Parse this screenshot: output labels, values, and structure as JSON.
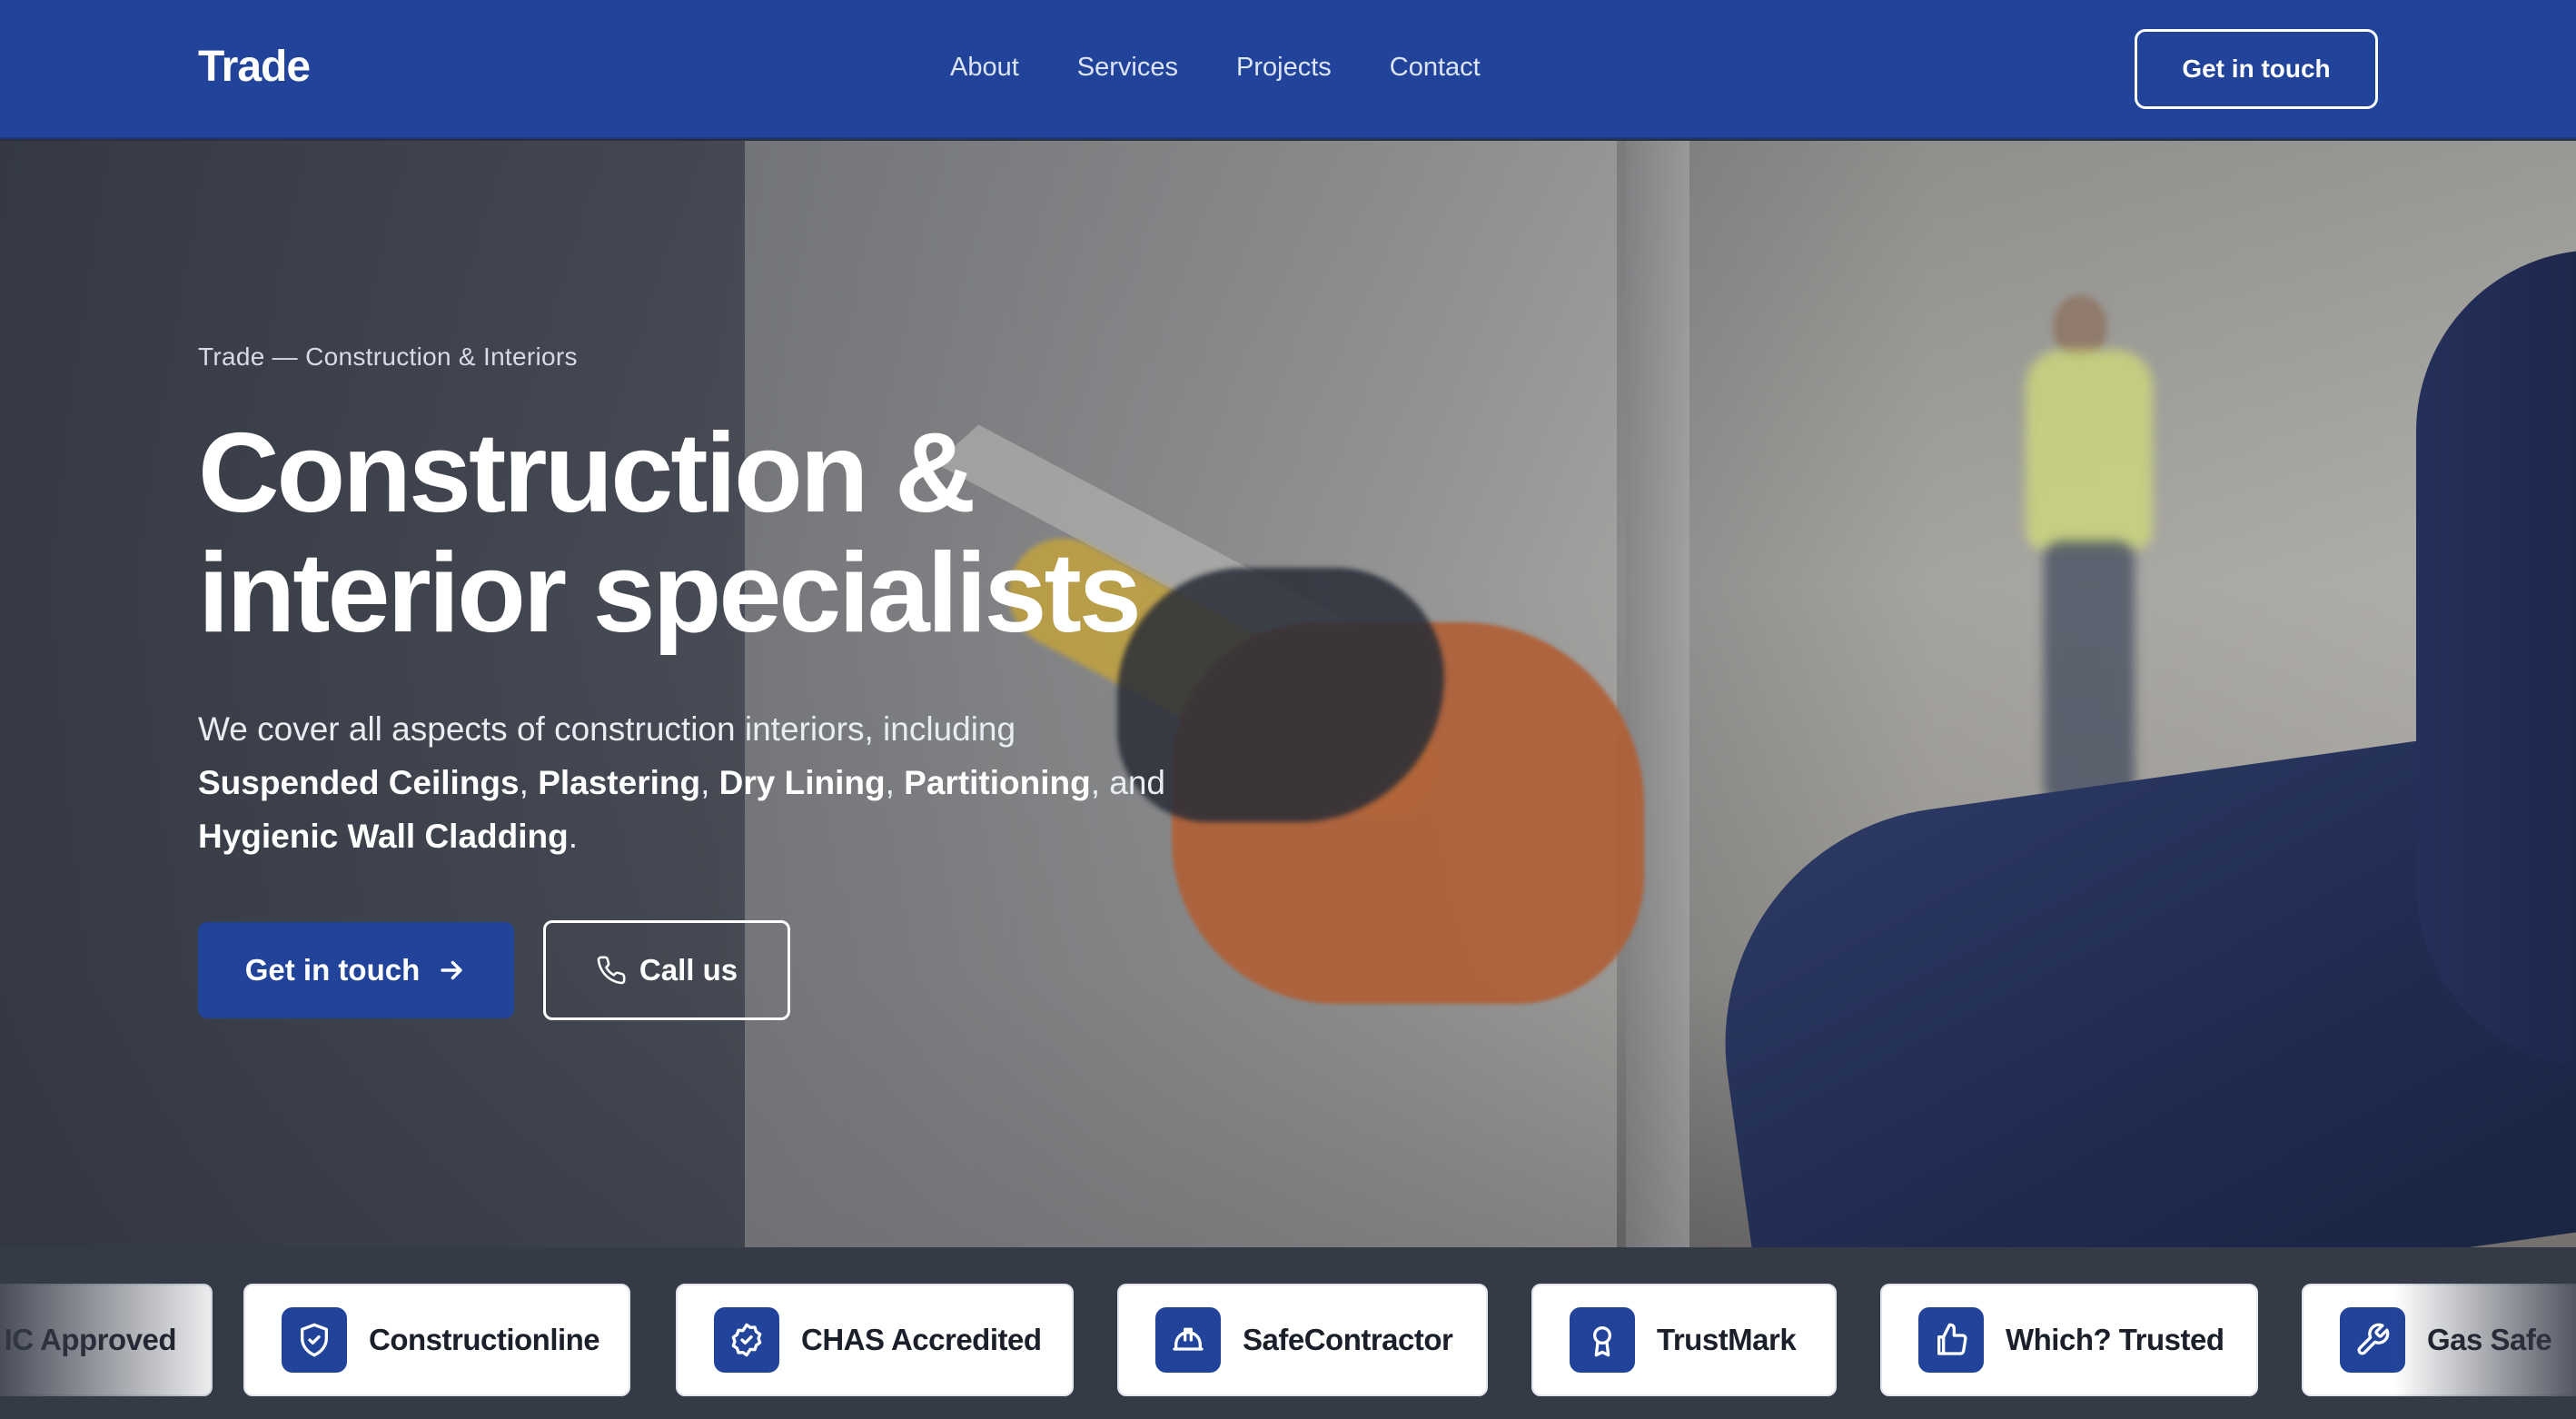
{
  "nav": {
    "brand": "Trade",
    "links": [
      "About",
      "Services",
      "Projects",
      "Contact"
    ],
    "cta": "Get in touch"
  },
  "hero": {
    "eyebrow": "Trade — Construction & Interiors",
    "title_line1": "Construction &",
    "title_line2": "interior specialists",
    "description": {
      "intro": "We cover all aspects of construction interiors, including",
      "services": [
        "Suspended Ceilings",
        "Plastering",
        "Dry Lining",
        "Partitioning",
        "Hygienic Wall Cladding"
      ],
      "sep1": ", ",
      "sep2": ", ",
      "sep3": ", ",
      "sep4": ", and",
      "end": "."
    },
    "primary_cta": "Get in touch",
    "secondary_cta": "Call us"
  },
  "accreditations": [
    {
      "label": "IC Approved",
      "icon": "partial-icon"
    },
    {
      "label": "Constructionline",
      "icon": "shield-check-icon"
    },
    {
      "label": "CHAS Accredited",
      "icon": "badge-check-icon"
    },
    {
      "label": "SafeContractor",
      "icon": "hard-hat-icon"
    },
    {
      "label": "TrustMark",
      "icon": "award-icon"
    },
    {
      "label": "Which? Trusted",
      "icon": "thumbs-up-icon"
    },
    {
      "label": "Gas Safe",
      "icon": "wrench-icon"
    }
  ],
  "colors": {
    "brand_blue": "#21449a",
    "white": "#ffffff",
    "strip_bg": "#353a47",
    "badge_text": "#1b1f2a"
  }
}
